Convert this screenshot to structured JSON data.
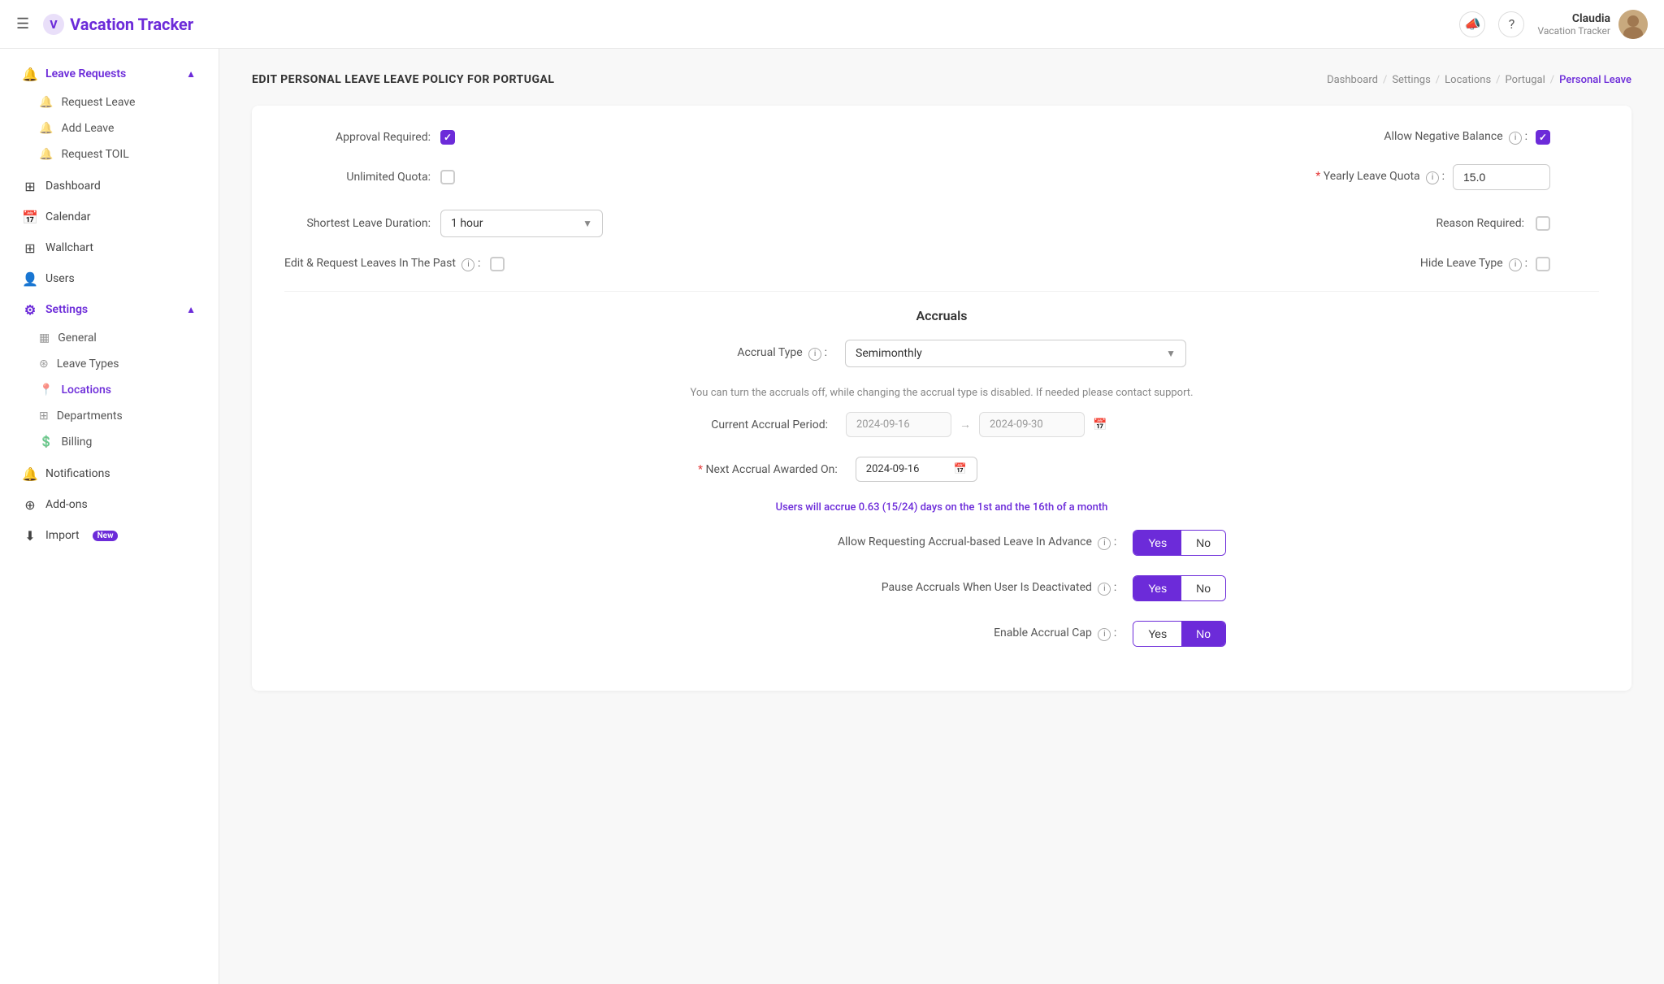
{
  "header": {
    "hamburger_label": "☰",
    "logo_text": "Vacation Tracker",
    "help_icon": "?",
    "bell_icon": "🔔",
    "user_name": "Claudia",
    "user_sub": "Vacation Tracker"
  },
  "sidebar": {
    "leave_requests_label": "Leave Requests",
    "request_leave_label": "Request Leave",
    "add_leave_label": "Add Leave",
    "request_toil_label": "Request TOIL",
    "dashboard_label": "Dashboard",
    "calendar_label": "Calendar",
    "wallchart_label": "Wallchart",
    "users_label": "Users",
    "settings_label": "Settings",
    "general_label": "General",
    "leave_types_label": "Leave Types",
    "locations_label": "Locations",
    "departments_label": "Departments",
    "billing_label": "Billing",
    "notifications_label": "Notifications",
    "addons_label": "Add-ons",
    "import_label": "Import",
    "import_badge": "New"
  },
  "page": {
    "title": "EDIT PERSONAL LEAVE LEAVE POLICY FOR PORTUGAL",
    "breadcrumb": {
      "dashboard": "Dashboard",
      "settings": "Settings",
      "locations": "Locations",
      "portugal": "Portugal",
      "current": "Personal Leave"
    }
  },
  "form": {
    "approval_required_label": "Approval Required:",
    "approval_required_checked": true,
    "allow_negative_balance_label": "Allow Negative Balance",
    "allow_negative_balance_checked": true,
    "unlimited_quota_label": "Unlimited Quota:",
    "unlimited_quota_checked": false,
    "yearly_leave_quota_label": "Yearly Leave Quota",
    "yearly_leave_quota_value": "15.0",
    "shortest_leave_duration_label": "Shortest Leave Duration:",
    "shortest_leave_duration_value": "1 hour",
    "reason_required_label": "Reason Required:",
    "reason_required_checked": false,
    "edit_request_leaves_label": "Edit & Request Leaves In The Past",
    "edit_request_leaves_checked": false,
    "hide_leave_type_label": "Hide Leave Type",
    "hide_leave_type_checked": false,
    "accruals_title": "Accruals",
    "accrual_type_label": "Accrual Type",
    "accrual_type_value": "Semimonthly",
    "accrual_type_note": "You can turn the accruals off, while changing the accrual type is disabled. If needed please contact support.",
    "current_accrual_period_label": "Current Accrual Period:",
    "accrual_period_start": "2024-09-16",
    "accrual_period_end": "2024-09-30",
    "next_accrual_awarded_label": "Next Accrual Awarded On:",
    "next_accrual_date": "2024-09-16",
    "accrual_highlight": "Users will accrue 0.63 (15/24) days on the 1st and the 16th of a month",
    "allow_requesting_accrual_label": "Allow Requesting Accrual-based Leave In Advance",
    "allow_requesting_accrual_yes": "Yes",
    "allow_requesting_accrual_no": "No",
    "allow_requesting_accrual_selected": "yes",
    "pause_accruals_label": "Pause Accruals When User Is Deactivated",
    "pause_accruals_yes": "Yes",
    "pause_accruals_no": "No",
    "pause_accruals_selected": "yes",
    "enable_accrual_cap_label": "Enable Accrual Cap",
    "enable_accrual_cap_yes": "Yes",
    "enable_accrual_cap_no": "No",
    "enable_accrual_cap_selected": "no"
  }
}
